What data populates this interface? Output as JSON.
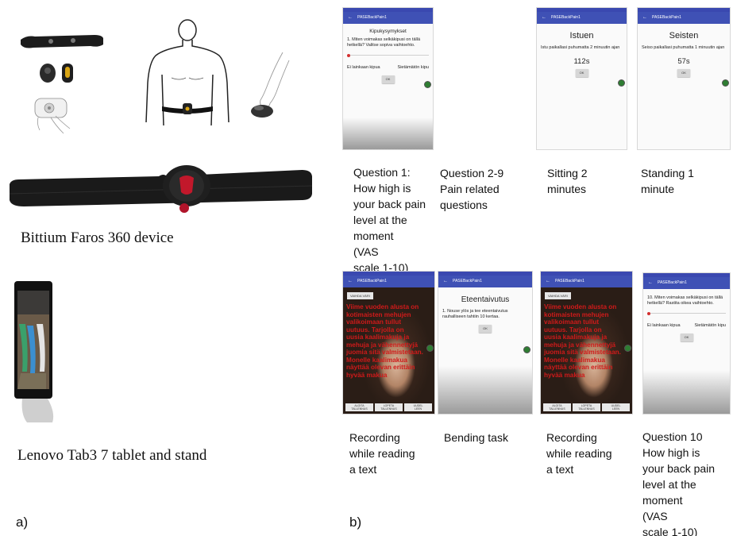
{
  "panel_a": {
    "letter": "a)",
    "device1_label": "Bittium Faros 360 device",
    "device2_label": "Lenovo Tab3 7 tablet and stand"
  },
  "panel_b": {
    "letter": "b)",
    "app_title": "PASEBackPain1",
    "screens": {
      "q1": {
        "header": "Kipukysymykset",
        "question": "1. Miten voimakas selkäkipusi on tällä hetkellä? Valitse sopiva vaihtoehto.",
        "min_label": "Ei lainkaan kipua",
        "max_label": "Sietämätön kipu",
        "ok": "OK"
      },
      "sitting": {
        "title": "Istuen",
        "instruction": "Istu paikallasi puhumatta 2 minuutin ajan",
        "timer": "112s",
        "ok": "OK"
      },
      "standing": {
        "title": "Seisten",
        "instruction": "Seiso paikallasi puhumatta 1 minuutin ajan",
        "timer": "57s",
        "ok": "OK"
      },
      "reading": {
        "vanda": "VAIHDA VÄRI",
        "text": "Viime vuoden alusta on\nkotimaisten mehujen\nvalikoimaan tullut\nuutuus. Tarjolla on\nuusia kaalimakuja ja\nmehuja ja vähennettyjä\njuomia sitä valmistetaan.\nMonelle kaalimakua\nnäyttää olevan erittäin\nhyvää makua",
        "btn1": "ALOITA\nTALLENNUS",
        "btn2": "LOPETA\nTALLENNUS",
        "btn3": "UUDEL\nLEEN"
      },
      "bending": {
        "title": "Eteentaivutus",
        "instruction": "1. Nouse ylös ja tee eteentaivutus rauhalliseen tahtiin 10 kertaa.",
        "ok": "OK"
      },
      "q10": {
        "question": "10. Miten voimakas selkäkipusi on tällä hetkellä? Rastita oikea vaihtoehto.",
        "min_label": "Ei lainkaan kipua",
        "max_label": "Sietämätön kipu",
        "ok": "OK"
      }
    },
    "captions": {
      "c1": "Question 1:\nHow high is\nyour back pain\nlevel at the\nmoment\n(VAS\nscale 1-10)",
      "c2": "Question 2-9\nPain related\nquestions",
      "c3": "Sitting 2\nminutes",
      "c4": "Standing 1\nminute",
      "c5": "Recording\nwhile reading\na text",
      "c6": "Bending task",
      "c7": "Recording\nwhile reading\na text",
      "c8": "Question 10\nHow high is\nyour back pain\nlevel at the\nmoment\n(VAS\n scale 1-10)"
    }
  },
  "colors": {
    "appbar": "#3f51b5",
    "reading_text": "#d01a1a",
    "fab": "#2e7d32",
    "device_red": "#c2182b"
  }
}
